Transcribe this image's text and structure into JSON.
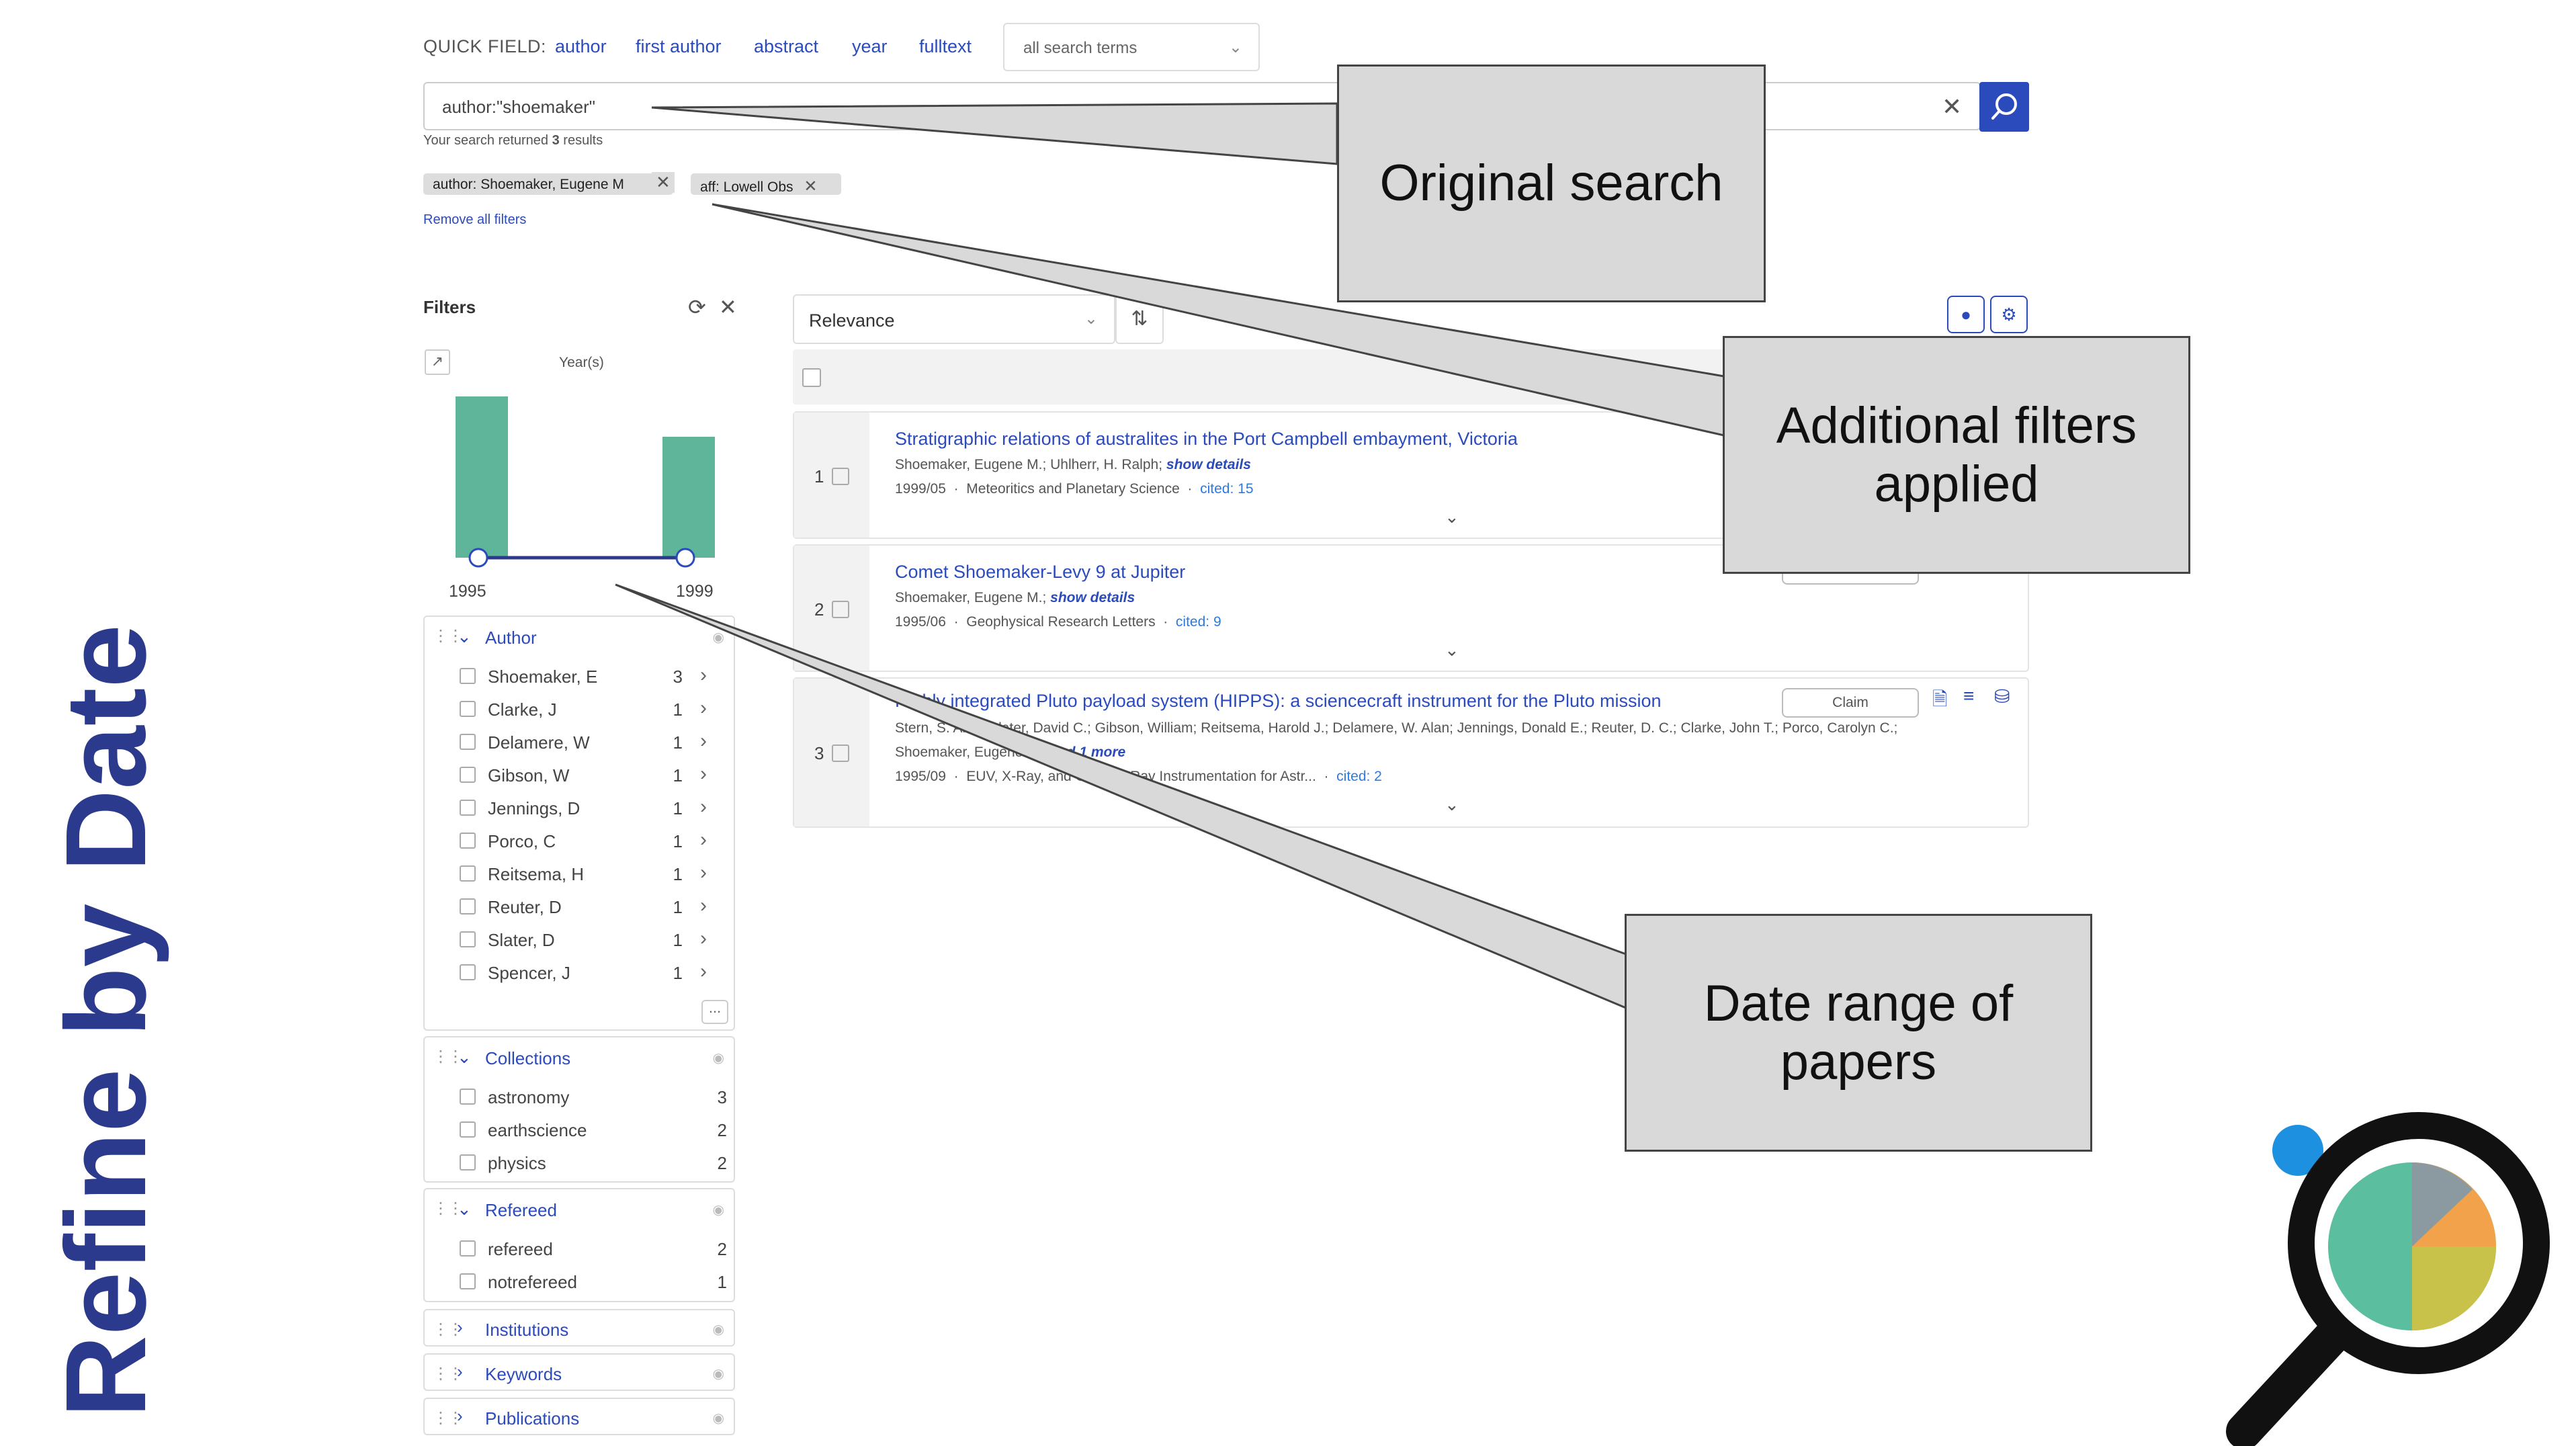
{
  "quick_field": {
    "label": "QUICK FIELD:",
    "links": [
      "author",
      "first author",
      "abstract",
      "year",
      "fulltext"
    ],
    "select_value": "all search terms"
  },
  "search": {
    "query": "author:\"shoemaker\"",
    "results_prefix": "Your search returned",
    "results_count": "3",
    "results_suffix": "results"
  },
  "active_filters": {
    "chips": [
      "author: Shoemaker, Eugene M",
      "aff: Lowell Obs"
    ],
    "remove_all": "Remove all filters"
  },
  "filters_panel": {
    "title": "Filters",
    "year_chart_label": "Year(s)",
    "year_start": "1995",
    "year_end": "1999"
  },
  "chart_data": {
    "type": "bar",
    "categories": [
      "1995",
      "1999"
    ],
    "values": [
      2,
      1.5
    ],
    "xlabel": "Year(s)",
    "ylabel": ""
  },
  "author_facet": {
    "title": "Author",
    "items": [
      {
        "label": "Shoemaker, E",
        "count": "3"
      },
      {
        "label": "Clarke, J",
        "count": "1"
      },
      {
        "label": "Delamere, W",
        "count": "1"
      },
      {
        "label": "Gibson, W",
        "count": "1"
      },
      {
        "label": "Jennings, D",
        "count": "1"
      },
      {
        "label": "Porco, C",
        "count": "1"
      },
      {
        "label": "Reitsema, H",
        "count": "1"
      },
      {
        "label": "Reuter, D",
        "count": "1"
      },
      {
        "label": "Slater, D",
        "count": "1"
      },
      {
        "label": "Spencer, J",
        "count": "1"
      }
    ],
    "more": "..."
  },
  "collections_facet": {
    "title": "Collections",
    "items": [
      {
        "label": "astronomy",
        "count": "3"
      },
      {
        "label": "earthscience",
        "count": "2"
      },
      {
        "label": "physics",
        "count": "2"
      }
    ]
  },
  "refereed_facet": {
    "title": "Refereed",
    "items": [
      {
        "label": "refereed",
        "count": "2"
      },
      {
        "label": "notrefereed",
        "count": "1"
      }
    ]
  },
  "collapsed_facets": [
    "Institutions",
    "Keywords",
    "Publications"
  ],
  "sort": {
    "value": "Relevance"
  },
  "results": [
    {
      "num": "1",
      "title": "Stratigraphic relations of australites in the Port Campbell embayment, Victoria",
      "authors": "Shoemaker, Eugene M.; Uhlherr, H. Ralph;",
      "show_details": "show details",
      "date": "1999/05",
      "journal": "Meteoritics and Planetary Science",
      "cited": "cited: 15"
    },
    {
      "num": "2",
      "title": "Comet Shoemaker-Levy 9 at Jupiter",
      "authors": "Shoemaker, Eugene M.;",
      "show_details": "show details",
      "date": "1995/06",
      "journal": "Geophysical Research Letters",
      "cited": "cited: 9",
      "claim": "Claim"
    },
    {
      "num": "3",
      "title": "Highly integrated Pluto payload system (HIPPS): a sciencecraft instrument for the Pluto mission",
      "authors": "Stern, S. Alan; Slater, David C.; Gibson, William; Reitsema, Harold J.; Delamere, W. Alan; Jennings, Donald E.; Reuter, D. C.; Clarke, John T.; Porco, Carolyn C.;",
      "authors2": "Shoemaker, Eugene M.;",
      "more_authors": "and 1 more",
      "date": "1995/09",
      "journal": "EUV, X-Ray, and Gamma-Ray Instrumentation for Astr...",
      "cited": "cited: 2",
      "claim": "Claim"
    }
  ],
  "callouts": {
    "original_search": "Original search",
    "filters_line1": "Additional filters",
    "filters_line2": "applied",
    "date_line1": "Date range of",
    "date_line2": "papers"
  },
  "side_title": "Refine by Date",
  "colors": {
    "accent": "#2b4bbd",
    "bar": "#5fb59a",
    "callout_bg": "#d9d9d9",
    "side_title": "#2b3a8c"
  }
}
